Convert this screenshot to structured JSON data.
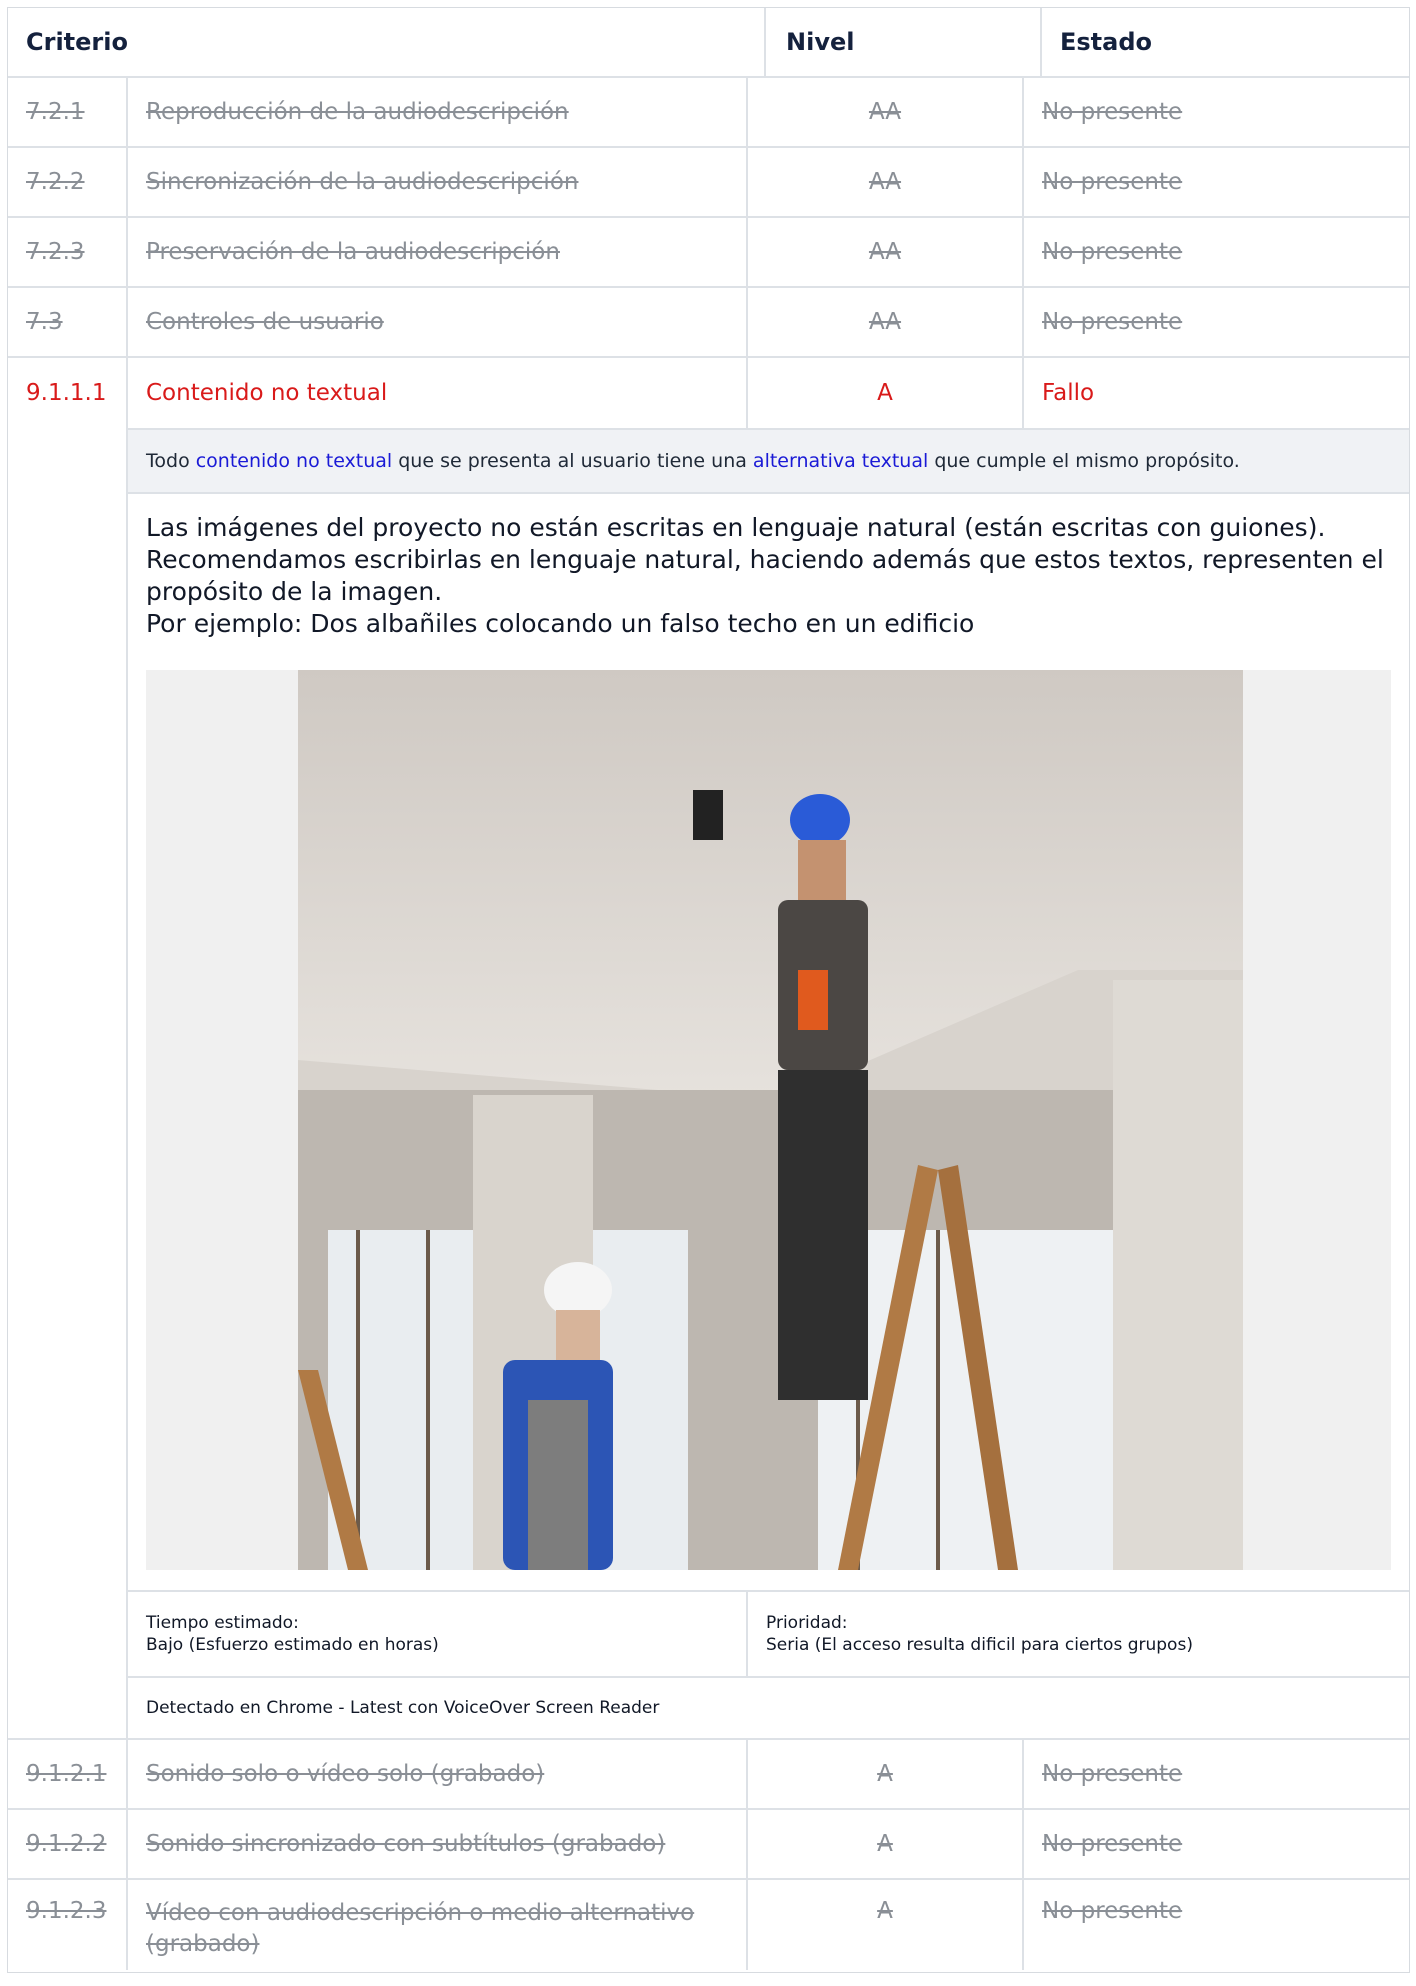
{
  "header": {
    "criterio": "Criterio",
    "nivel": "Nivel",
    "estado": "Estado"
  },
  "rows_before": [
    {
      "id": "7.2.1",
      "name": "Reproducción de la audiodescripción",
      "level": "AA",
      "status": "No presente"
    },
    {
      "id": "7.2.2",
      "name": "Sincronización de la audiodescripción",
      "level": "AA",
      "status": "No presente"
    },
    {
      "id": "7.2.3",
      "name": "Preservación de la audiodescripción",
      "level": "AA",
      "status": "No presente"
    },
    {
      "id": "7.3",
      "name": "Controles de usuario",
      "level": "AA",
      "status": "No presente"
    }
  ],
  "failed_row": {
    "id": "9.1.1.1",
    "name": "Contenido no textual",
    "level": "A",
    "status": "Fallo"
  },
  "definition": {
    "prefix": "Todo ",
    "link1": "contenido no textual",
    "middle": " que se presenta al usuario tiene una ",
    "link2": "alternativa textual",
    "suffix": " que cumple el mismo propósito."
  },
  "comment": {
    "line1": "Las imágenes del proyecto no están escritas en lenguaje natural (están escritas con guiones). Recomendamos escribirlas en lenguaje natural, haciendo además que estos textos, representen el propósito de la imagen.",
    "line2": "Por ejemplo: Dos albañiles colocando un falso techo en un edificio"
  },
  "meta": {
    "time_label": "Tiempo estimado:",
    "time_value": "Bajo (Esfuerzo estimado en horas)",
    "priority_label": "Prioridad:",
    "priority_value": "Seria (El acceso resulta dificil para ciertos grupos)"
  },
  "detected": "Detectado en Chrome - Latest con VoiceOver Screen Reader",
  "rows_after": [
    {
      "id": "9.1.2.1",
      "name": "Sonido solo o vídeo solo (grabado)",
      "level": "A",
      "status": "No presente"
    },
    {
      "id": "9.1.2.2",
      "name": "Sonido sincronizado con subtítulos (grabado)",
      "level": "A",
      "status": "No presente"
    },
    {
      "id": "9.1.2.3",
      "name": "Vídeo con audiodescripción o medio alternativo (grabado)",
      "level": "A",
      "status": "No presente"
    }
  ],
  "colors": {
    "fail": "#d91a1a",
    "link": "#1a1ad6",
    "muted": "#8a8f96"
  }
}
